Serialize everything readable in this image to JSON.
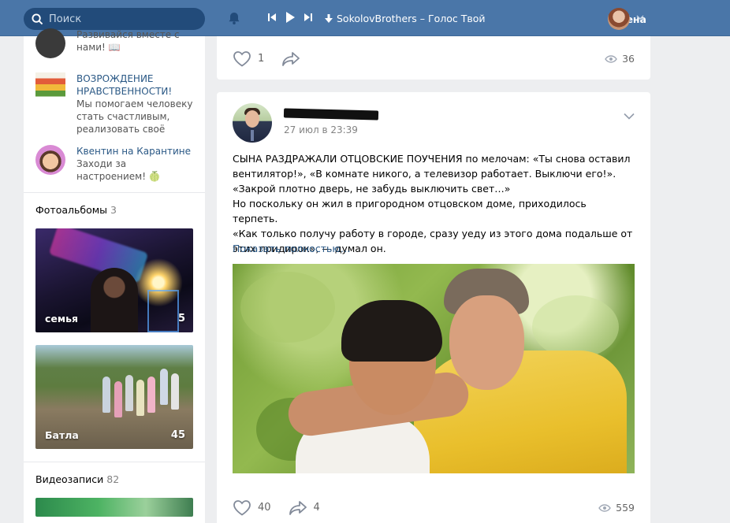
{
  "topbar": {
    "search_placeholder": "Поиск",
    "track_title": "SokolovBrothers – Голос Твой",
    "user_name": "Алена"
  },
  "groups": [
    {
      "title": "",
      "desc": "Развивайся вместе с нами! 📖"
    },
    {
      "title": "ВОЗРОЖДЕНИЕ НРАВСТВЕННОСТИ!",
      "desc": "Мы помогаем человеку стать счастливым, реализовать своё"
    },
    {
      "title": "Квентин на Карантине",
      "desc": "Заходи за настроением! 🍈"
    }
  ],
  "photo_albums": {
    "label": "Фотоальбомы",
    "count": "3",
    "items": [
      {
        "caption": "семья",
        "count": "5"
      },
      {
        "caption": "Батла",
        "count": "45"
      }
    ]
  },
  "videos": {
    "label": "Видеозаписи",
    "count": "82"
  },
  "prev_post": {
    "likes": "1",
    "views": "36"
  },
  "post": {
    "date": "27 июл в 23:39",
    "text_lines": [
      "СЫНА РАЗДРАЖАЛИ ОТЦОВСКИЕ ПОУЧЕНИЯ по мелочам: «Ты снова оставил вентилятор!», «В комнате никого, а телевизор работает. Выключи его!». «Закрой плотно дверь, не забудь выключить свет…»",
      "Но поскольку он жил в пригородном отцовском доме, приходилось терпеть.",
      "«Как только получу работу в городе, сразу уеду из этого дома подальше от этих придирок», — думал он."
    ],
    "show_more": "Показать полностью…",
    "likes": "40",
    "shares": "4",
    "views": "559"
  },
  "colors": {
    "header": "#4a76a8",
    "link": "#2a5885",
    "background": "#edeef0"
  }
}
